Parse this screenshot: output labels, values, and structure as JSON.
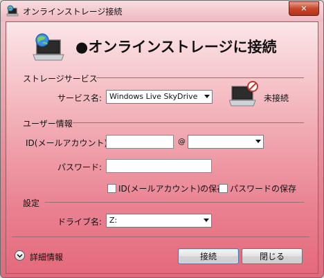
{
  "window": {
    "title": "オンラインストレージ接続",
    "close_glyph": "✕"
  },
  "header": {
    "heading": "●オンラインストレージに接続"
  },
  "storage_service": {
    "section_label": "ストレージサービス",
    "service_label": "サービス名:",
    "service_value": "Windows Live SkyDrive",
    "status_text": "未接続",
    "status_icon": "computer-disconnected-icon"
  },
  "user_info": {
    "section_label": "ユーザー情報",
    "id_label": "ID(メールアカウント):",
    "id_value": "",
    "at_sign": "@",
    "domain_value": "",
    "password_label": "パスワード:",
    "password_value": "",
    "save_id_label": "ID(メールアカウント)の保存",
    "save_password_label": "パスワードの保存",
    "save_id_checked": false,
    "save_password_checked": false
  },
  "settings": {
    "section_label": "設定",
    "drive_label": "ドライブ名:",
    "drive_value": "Z:"
  },
  "footer": {
    "details_label": "詳細情報",
    "connect_label": "接続",
    "close_label": "閉じる"
  },
  "colors": {
    "background_top": "#fbe6e8",
    "background_bottom": "#e46a7b",
    "close_button": "#c7472b"
  }
}
